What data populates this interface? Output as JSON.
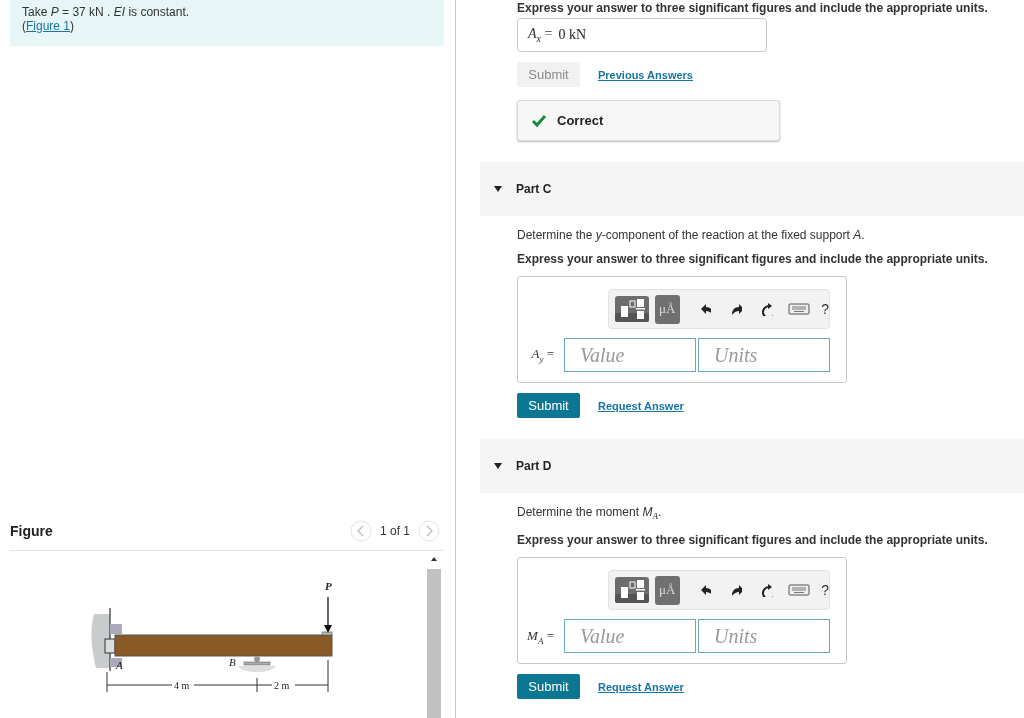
{
  "problem": {
    "text": "Take *P* = 37  kN . *EI* is constant.",
    "figure_ref": {
      "before": "(",
      "link": "Figure 1",
      "after": ")"
    }
  },
  "figure": {
    "title": "Figure",
    "pager": "1 of 1",
    "labels": {
      "load": "P",
      "support_a": "A",
      "support_b": "B",
      "span_1": "4 m",
      "span_2": "2 m"
    }
  },
  "part_b": {
    "instruction": "Express your answer to three significant figures and include the appropriate units.",
    "answer_label": "*A*$_{x}$ =",
    "answer_value": "0 kN",
    "submit": {
      "label": "Submit",
      "disabled": true
    },
    "link": "Previous Answers",
    "feedback": {
      "kind": "correct",
      "text": "Correct"
    }
  },
  "parts": [
    {
      "title": "Part C",
      "expanded": true,
      "prompt": "Determine the *y*-component of the reaction at the fixed support *A*.",
      "instruction": "Express your answer to three significant figures and include the appropriate units.",
      "units_button": "μÅ",
      "help": "?",
      "answer_label": "*A*$_{y}$ =",
      "value_placeholder": "Value",
      "units_placeholder": "Units",
      "submit": {
        "label": "Submit",
        "disabled": false
      },
      "link": "Request Answer"
    },
    {
      "title": "Part D",
      "expanded": true,
      "prompt": "Determine the moment *M*$_{A}$.",
      "instruction": "Express your answer to three significant figures and include the appropriate units.",
      "units_button": "μÅ",
      "help": "?",
      "answer_label": "*M*$_{A}$ =",
      "value_placeholder": "Value",
      "units_placeholder": "Units",
      "submit": {
        "label": "Submit",
        "disabled": false
      },
      "link": "Request Answer"
    }
  ]
}
